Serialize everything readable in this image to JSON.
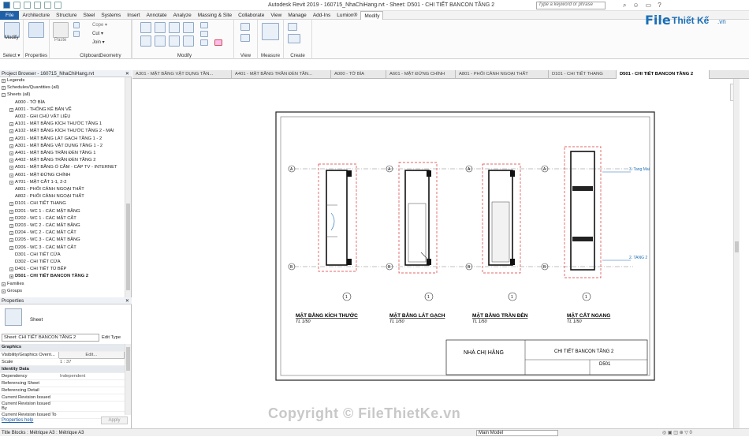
{
  "app": {
    "title": "Autodesk Revit 2019 - 160715_NhaChiHang.rvt - Sheet: D501 - CHI TIẾT BANCON TẦNG 2",
    "search_placeholder": "Type a keyword or phrase"
  },
  "menu": [
    "File",
    "Architecture",
    "Structure",
    "Steel",
    "Systems",
    "Insert",
    "Annotate",
    "Analyze",
    "Massing & Site",
    "Collaborate",
    "View",
    "Manage",
    "Add-Ins",
    "Lumion®",
    "Modify"
  ],
  "ribbon": {
    "groups": [
      "Select ▾",
      "Properties",
      "Clipboard",
      "Geometry",
      "Modify",
      "View",
      "Measure",
      "Create"
    ],
    "tool_labels": {
      "modify": "Modify",
      "properties": "Properties",
      "paste": "Paste",
      "cope": "Cope ▾",
      "cut": "Cut ▾",
      "join": "Join ▾"
    }
  },
  "logo": {
    "file": "File",
    "brand": "Thiết Kế",
    ".vn": ".vn"
  },
  "browser": {
    "title": "Project Browser - 160715_NhaChiHang.rvt",
    "items": [
      {
        "t": "Legends",
        "lvl": 0,
        "box": "+"
      },
      {
        "t": "Schedules/Quantities (all)",
        "lvl": 0,
        "box": "+"
      },
      {
        "t": "Sheets (all)",
        "lvl": 0,
        "box": "-"
      },
      {
        "t": "A000 - TỜ BÌA",
        "lvl": 1,
        "box": ""
      },
      {
        "t": "A001 - THỐNG KÊ BẢN VẼ",
        "lvl": 1,
        "box": "+"
      },
      {
        "t": "A002 - GHI CHÚ VẬT LIỆU",
        "lvl": 1,
        "box": ""
      },
      {
        "t": "A101 - MẶT BẰNG KÍCH THƯỚC TẦNG 1",
        "lvl": 1,
        "box": "+"
      },
      {
        "t": "A102 - MẶT BẰNG KÍCH THƯỚC TẦNG 2 - MÁI",
        "lvl": 1,
        "box": "+"
      },
      {
        "t": "A201 - MẶT BẰNG LÁT GẠCH TẦNG 1 - 2",
        "lvl": 1,
        "box": "+"
      },
      {
        "t": "A301 - MẶT BẰNG VẬT DỤNG TẦNG 1 - 2",
        "lvl": 1,
        "box": "+"
      },
      {
        "t": "A401 - MẶT BẰNG TRẦN ĐÈN TẦNG 1",
        "lvl": 1,
        "box": "+"
      },
      {
        "t": "A402 - MẶT BẰNG TRẦN ĐÈN TẦNG 2",
        "lvl": 1,
        "box": "+"
      },
      {
        "t": "A501 - MẶT BẰNG Ổ CẮM - CÁP TV - INTERNET",
        "lvl": 1,
        "box": "+"
      },
      {
        "t": "A601 - MẶT ĐỨNG CHÍNH",
        "lvl": 1,
        "box": "+"
      },
      {
        "t": "A701 - MẶT CẮT 1-1, 2-2",
        "lvl": 1,
        "box": "+"
      },
      {
        "t": "A801 - PHỐI CẢNH NGOẠI THẤT",
        "lvl": 1,
        "box": ""
      },
      {
        "t": "A802 - PHỐI CẢNH NGOẠI THẤT",
        "lvl": 1,
        "box": ""
      },
      {
        "t": "D101 - CHI TIẾT THANG",
        "lvl": 1,
        "box": "+"
      },
      {
        "t": "D201 - WC 1 - CÁC MẶT BẰNG",
        "lvl": 1,
        "box": "+"
      },
      {
        "t": "D202 - WC 1 - CÁC MẶT CẮT",
        "lvl": 1,
        "box": "+"
      },
      {
        "t": "D203 - WC 2 - CÁC MẶT BẰNG",
        "lvl": 1,
        "box": "+"
      },
      {
        "t": "D204 - WC 2 - CÁC MẶT CẮT",
        "lvl": 1,
        "box": "+"
      },
      {
        "t": "D205 - WC 3 - CÁC MẶT BẰNG",
        "lvl": 1,
        "box": "+"
      },
      {
        "t": "D206 - WC 3 - CÁC MẶT CẮT",
        "lvl": 1,
        "box": "+"
      },
      {
        "t": "D301 - CHI TIẾT CỬA",
        "lvl": 1,
        "box": ""
      },
      {
        "t": "D302 - CHI TIẾT CỬA",
        "lvl": 1,
        "box": ""
      },
      {
        "t": "D401 - CHI TIẾT TỦ BẾP",
        "lvl": 1,
        "box": "+"
      },
      {
        "t": "D501 - CHI TIẾT BANCON TẦNG 2",
        "lvl": 1,
        "box": "+",
        "sel": true
      },
      {
        "t": "Families",
        "lvl": 0,
        "box": "+"
      },
      {
        "t": "Groups",
        "lvl": 0,
        "box": "+"
      }
    ]
  },
  "properties": {
    "title": "Properties",
    "type": "Sheet",
    "selector": "Sheet: CHI TIẾT BANCON TẦNG 2",
    "edit_type": "Edit Type",
    "rows": [
      {
        "k": "Graphics",
        "v": "",
        "section": true
      },
      {
        "k": "Visibility/Graphics Overri...",
        "v": "Edit..."
      },
      {
        "k": "Scale",
        "v": "1 : 37"
      },
      {
        "k": "Identity Data",
        "v": "",
        "section": true
      },
      {
        "k": "Dependency",
        "v": "Independent"
      },
      {
        "k": "Referencing Sheet",
        "v": ""
      },
      {
        "k": "Referencing Detail",
        "v": ""
      },
      {
        "k": "Current Revision Issued",
        "v": ""
      },
      {
        "k": "Current Revision Issued By",
        "v": ""
      },
      {
        "k": "Current Revision Issued To",
        "v": ""
      }
    ],
    "help": "Properties help",
    "apply": "Apply"
  },
  "tabs": [
    "A301 - MẶT BẰNG VẬT DỤNG TẦN...",
    "A401 - MẶT BẰNG TRẦN ĐÈN TẦN...",
    "A000 - TỜ BÌA",
    "A601 - MẶT ĐỨNG CHÍNH",
    "A801 - PHỐI CẢNH NGOẠI THẤT",
    "D101 - CHI TIẾT THANG",
    "D501 - CHI TIẾT BANCON TẦNG 2"
  ],
  "sheet": {
    "views": [
      {
        "name": "MẶT BẰNG KÍCH THƯỚC",
        "scale": "TL 1/50"
      },
      {
        "name": "MẶT BẰNG LÁT GẠCH",
        "scale": "TL 1/50"
      },
      {
        "name": "MẶT BẰNG TRẦN ĐÈN",
        "scale": "TL 1/50"
      },
      {
        "name": "MẶT CẮT NGANG",
        "scale": "TL 1/50"
      }
    ],
    "grid": {
      "a": "A",
      "b": "B",
      "one": "1"
    },
    "levels": {
      "l3": "3. Tang Mai",
      "l2": "2. TANG 2"
    },
    "titleblock": {
      "project": "NHÀ CHỊ HẰNG",
      "sheet_title": "CHI TIẾT BANCON TẦNG 2",
      "sheet_no": "D501"
    }
  },
  "status": {
    "left": "Title Blocks : Métrique A3 : Métrique A3",
    "model": "Main Model"
  },
  "watermark": "Copyright © FileThietKe.vn"
}
